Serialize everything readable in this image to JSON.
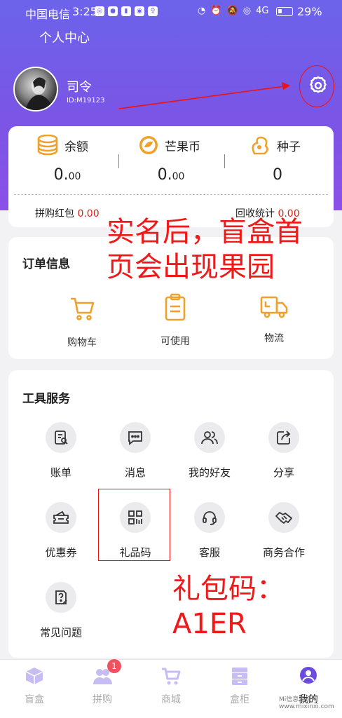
{
  "status_bar": {
    "carrier": "中国电信",
    "time": "3:25",
    "battery": "29%",
    "network": "4G"
  },
  "header": {
    "title": "个人中心"
  },
  "profile": {
    "name": "司令",
    "id": "ID:M19123"
  },
  "wallet": {
    "items": [
      {
        "label": "余额",
        "value_main": "0.",
        "value_frac": "00"
      },
      {
        "label": "芒果币",
        "value_main": "0.",
        "value_frac": "00"
      },
      {
        "label": "种子",
        "value_main": "0",
        "value_frac": ""
      }
    ],
    "sub": [
      {
        "label": "拼购红包",
        "value": "0.00"
      },
      {
        "label": "回收统计",
        "value": "0.00"
      }
    ]
  },
  "orders": {
    "title": "订单信息",
    "items": [
      {
        "label": "购物车",
        "icon": "cart-icon"
      },
      {
        "label": "可使用",
        "icon": "clipboard-icon"
      },
      {
        "label": "物流",
        "icon": "truck-icon"
      }
    ]
  },
  "tools": {
    "title": "工具服务",
    "items": [
      {
        "label": "账单",
        "icon": "bill-icon"
      },
      {
        "label": "消息",
        "icon": "message-icon"
      },
      {
        "label": "我的好友",
        "icon": "friends-icon"
      },
      {
        "label": "分享",
        "icon": "share-icon"
      },
      {
        "label": "优惠券",
        "icon": "coupon-icon"
      },
      {
        "label": "礼品码",
        "icon": "qrcode-icon"
      },
      {
        "label": "客服",
        "icon": "headset-icon"
      },
      {
        "label": "商务合作",
        "icon": "handshake-icon"
      },
      {
        "label": "常见问题",
        "icon": "faq-icon"
      }
    ]
  },
  "annotations": {
    "realname_line1": "实名后，盲盒首",
    "realname_line2": "页会出现果园",
    "gift_line1": "礼包码：",
    "gift_line2": "A1ER"
  },
  "nav": {
    "items": [
      {
        "label": "盲盒",
        "icon": "blindbox-icon"
      },
      {
        "label": "拼购",
        "icon": "group-buy-icon",
        "badge": "1"
      },
      {
        "label": "商城",
        "icon": "mall-cart-icon"
      },
      {
        "label": "盒柜",
        "icon": "cabinet-icon"
      },
      {
        "label": "我的",
        "icon": "me-icon"
      }
    ]
  },
  "watermark": {
    "line1": "Mi信息查询网",
    "line2": "www.mixinxi.com"
  },
  "colors": {
    "accent": "#6c63ea",
    "orange": "#f0a12a",
    "red": "#e31c1c"
  }
}
